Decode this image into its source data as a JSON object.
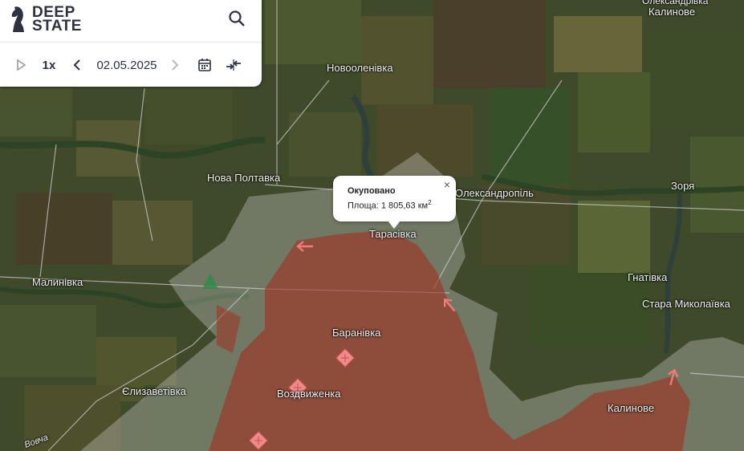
{
  "app": {
    "logo_line1": "DEEP",
    "logo_line2": "STATE"
  },
  "controls": {
    "speed": "1x",
    "date": "02.05.2025"
  },
  "icons": {
    "search": "search-icon",
    "play": "play-icon",
    "prev": "chevron-left-icon",
    "next": "chevron-right-icon",
    "calendar": "calendar-icon",
    "compare": "compare-arrows-icon",
    "close": "close-icon",
    "attack_arrow": "attack-arrow-icon",
    "unit_marker": "unit-marker-icon"
  },
  "popup": {
    "title": "Окуповано",
    "area_prefix": "Площа: 1 805,63 км",
    "area_sup": "2",
    "close": "×"
  },
  "places": {
    "kalynove_top_small": "Олександрівка",
    "kalynove_top": "Калинове",
    "novooleniv": "Новооленівка",
    "nova_poltavka": "Нова Полтавка",
    "oleksandropil": "Олександропіль",
    "zorya": "Зоря",
    "tarasivka": "Тарасівка",
    "malynivka": "Малинівка",
    "hnativka": "Гнатівка",
    "stara_mykolaivka": "Стара Миколаївка",
    "baranivka": "Баранівка",
    "yelyzavetivka": "Єлизаветівка",
    "vozdvyzhenka": "Воздвиженка",
    "kalynove": "Калинове",
    "river": "Вовча"
  },
  "colors": {
    "occupied": "#a03222",
    "gray_zone": "#d9d9d9",
    "arrow": "#f07a7a",
    "unit": "#f08a8a"
  }
}
